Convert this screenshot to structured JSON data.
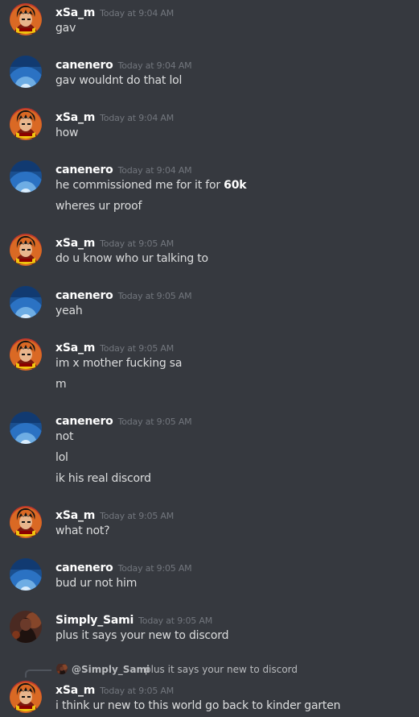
{
  "colors": {
    "background": "#36393f",
    "username": "#ffffff",
    "timestamp": "#72767d",
    "message_text": "#dcddde"
  },
  "messages": [
    {
      "user": "xSa_m",
      "avatar": "xsam-avatar",
      "time": "Today at 9:04 AM",
      "lines": [
        "gav"
      ]
    },
    {
      "user": "canenero",
      "avatar": "canenero-avatar",
      "time": "Today at 9:04 AM",
      "lines": [
        "gav wouldnt do that lol"
      ]
    },
    {
      "user": "xSa_m",
      "avatar": "xsam-avatar",
      "time": "Today at 9:04 AM",
      "lines": [
        "how"
      ]
    },
    {
      "user": "canenero",
      "avatar": "canenero-avatar",
      "time": "Today at 9:04 AM",
      "lines": [
        "he commissioned me for it for 60k",
        "wheres ur proof"
      ]
    },
    {
      "user": "xSa_m",
      "avatar": "xsam-avatar",
      "time": "Today at 9:05 AM",
      "lines": [
        "do u know who ur talking to"
      ]
    },
    {
      "user": "canenero",
      "avatar": "canenero-avatar",
      "time": "Today at 9:05 AM",
      "lines": [
        "yeah"
      ]
    },
    {
      "user": "xSa_m",
      "avatar": "xsam-avatar",
      "time": "Today at 9:05 AM",
      "lines": [
        "im x mother fucking sa",
        "m"
      ]
    },
    {
      "user": "canenero",
      "avatar": "canenero-avatar",
      "time": "Today at 9:05 AM",
      "lines": [
        "not",
        "lol",
        "ik his real discord"
      ]
    },
    {
      "user": "xSa_m",
      "avatar": "xsam-avatar",
      "time": "Today at 9:05 AM",
      "lines": [
        "what not?"
      ]
    },
    {
      "user": "canenero",
      "avatar": "canenero-avatar",
      "time": "Today at 9:05 AM",
      "lines": [
        "bud ur not him"
      ]
    },
    {
      "user": "Simply_Sami",
      "avatar": "simply-sami-avatar",
      "time": "Today at 9:05 AM",
      "lines": [
        "plus it says your new to discord"
      ]
    },
    {
      "user": "xSa_m",
      "avatar": "xsam-avatar",
      "time": "Today at 9:05 AM",
      "lines": [
        "i think ur new to this world go back to kinder garten"
      ]
    }
  ],
  "reply": {
    "mention": "@Simply_Sami",
    "text": "plus it says your new to discord"
  }
}
